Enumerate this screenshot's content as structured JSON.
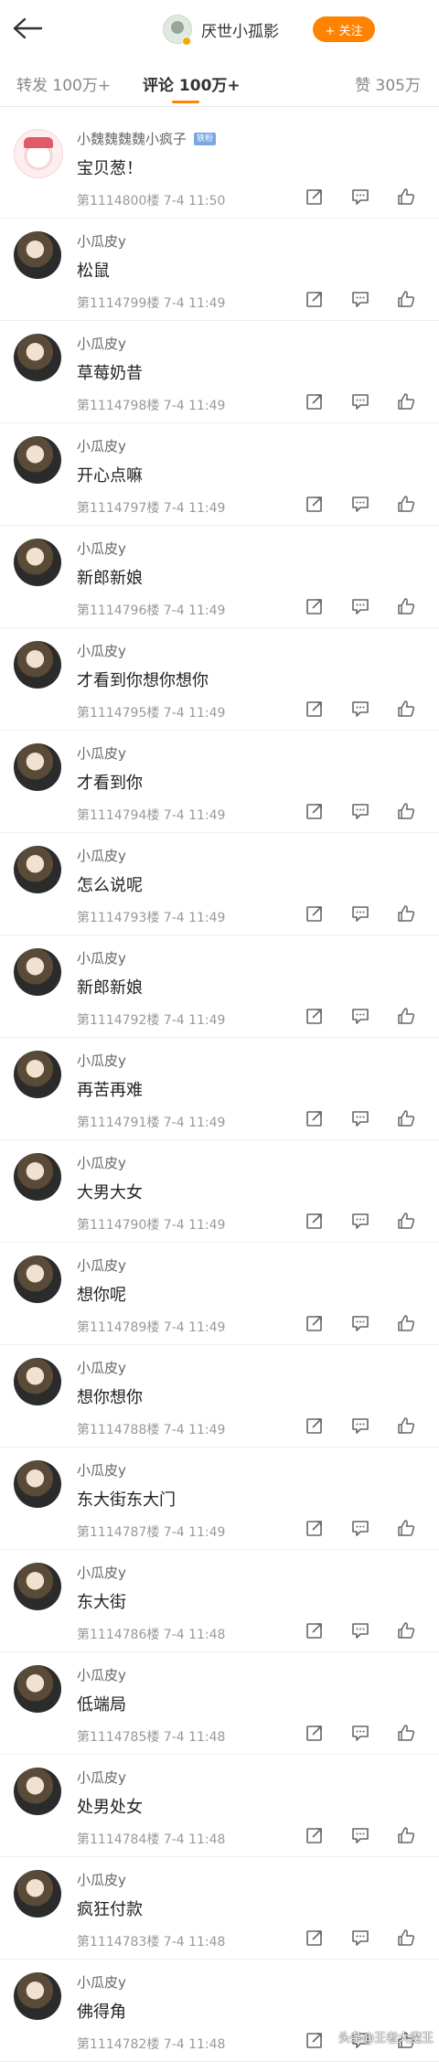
{
  "header": {
    "account_name": "厌世小孤影",
    "follow_label": "+ 关注",
    "icons": {
      "back": "back-arrow-icon"
    }
  },
  "tabs": {
    "repost": "转发 100万+",
    "comment": "评论 100万+",
    "like": "赞 305万"
  },
  "colors": {
    "accent": "#ff8200",
    "badge": "#7aa7e0"
  },
  "comments": [
    {
      "user": "小魏魏魏魏小疯子",
      "badge": "铁粉",
      "text": "宝贝葱！",
      "meta": "第1114800楼  7-4 11:50"
    },
    {
      "user": "小瓜皮y",
      "text": "松鼠",
      "meta": "第1114799楼  7-4 11:49"
    },
    {
      "user": "小瓜皮y",
      "text": "草莓奶昔",
      "meta": "第1114798楼  7-4 11:49"
    },
    {
      "user": "小瓜皮y",
      "text": "开心点嘛",
      "meta": "第1114797楼  7-4 11:49"
    },
    {
      "user": "小瓜皮y",
      "text": "新郎新娘",
      "meta": "第1114796楼  7-4 11:49"
    },
    {
      "user": "小瓜皮y",
      "text": "才看到你想你想你",
      "meta": "第1114795楼  7-4 11:49"
    },
    {
      "user": "小瓜皮y",
      "text": "才看到你",
      "meta": "第1114794楼  7-4 11:49"
    },
    {
      "user": "小瓜皮y",
      "text": "怎么说呢",
      "meta": "第1114793楼  7-4 11:49"
    },
    {
      "user": "小瓜皮y",
      "text": "新郎新娘",
      "meta": "第1114792楼  7-4 11:49"
    },
    {
      "user": "小瓜皮y",
      "text": "再苦再难",
      "meta": "第1114791楼  7-4 11:49"
    },
    {
      "user": "小瓜皮y",
      "text": "大男大女",
      "meta": "第1114790楼  7-4 11:49"
    },
    {
      "user": "小瓜皮y",
      "text": "想你呢",
      "meta": "第1114789楼  7-4 11:49"
    },
    {
      "user": "小瓜皮y",
      "text": "想你想你",
      "meta": "第1114788楼  7-4 11:49"
    },
    {
      "user": "小瓜皮y",
      "text": "东大街东大门",
      "meta": "第1114787楼  7-4 11:49"
    },
    {
      "user": "小瓜皮y",
      "text": "东大街",
      "meta": "第1114786楼  7-4 11:48"
    },
    {
      "user": "小瓜皮y",
      "text": "低端局",
      "meta": "第1114785楼  7-4 11:48"
    },
    {
      "user": "小瓜皮y",
      "text": "处男处女",
      "meta": "第1114784楼  7-4 11:48"
    },
    {
      "user": "小瓜皮y",
      "text": "疯狂付款",
      "meta": "第1114783楼  7-4 11:48"
    },
    {
      "user": "小瓜皮y",
      "text": "佛得角",
      "meta": "第1114782楼  7-4 11:48"
    }
  ],
  "watermark": "头条@王者大魔王"
}
